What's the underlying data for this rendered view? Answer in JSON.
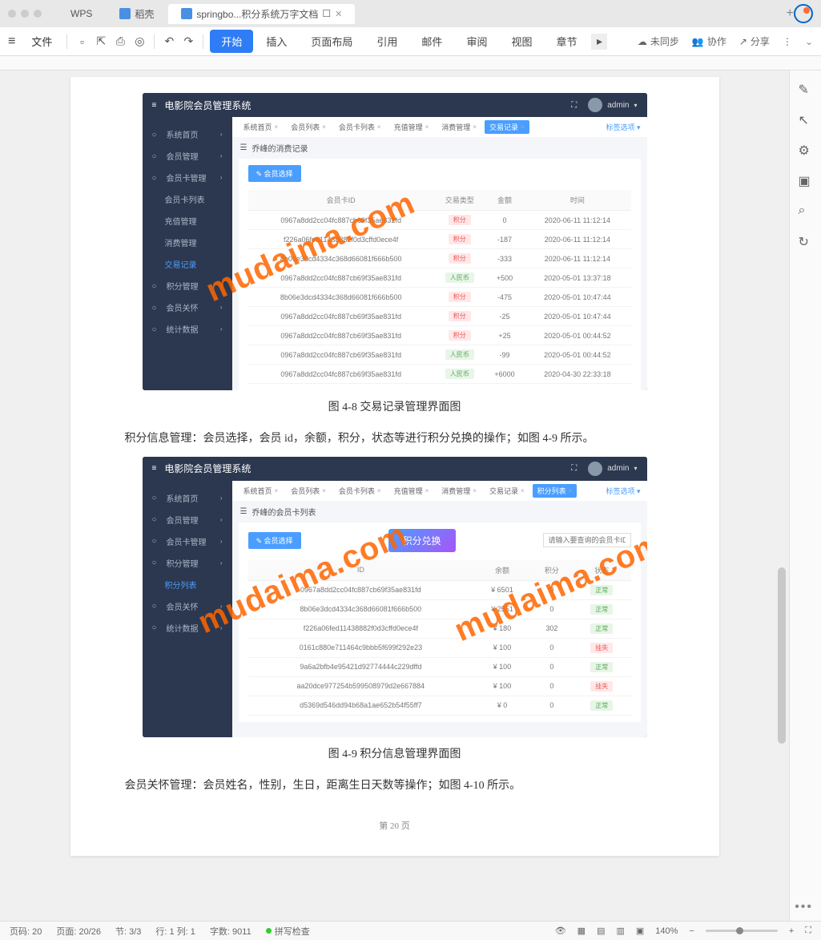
{
  "titlebar": {
    "tabs": [
      {
        "label": "WPS"
      },
      {
        "label": "稻壳"
      },
      {
        "label": "springbo...积分系统万字文档",
        "active": true
      }
    ]
  },
  "menubar": {
    "file": "文件",
    "items": [
      "开始",
      "插入",
      "页面布局",
      "引用",
      "邮件",
      "审阅",
      "视图",
      "章节"
    ],
    "active": 0,
    "sync": [
      {
        "label": "未同步"
      },
      {
        "label": "协作"
      },
      {
        "label": "分享"
      }
    ]
  },
  "doc": {
    "caption1": "图 4-8 交易记录管理界面图",
    "paragraph1": "积分信息管理：会员选择，会员 id，余额，积分，状态等进行积分兑换的操作；如图 4-9 所示。",
    "caption2": "图 4-9 积分信息管理界面图",
    "paragraph2": "会员关怀管理：会员姓名，性别，生日，距离生日天数等操作；如图 4-10 所示。",
    "pagefoot": "第 20 页"
  },
  "embed1": {
    "title": "电影院会员管理系统",
    "admin": "admin",
    "sidebar": [
      "系统首页",
      "会员管理",
      "会员卡管理",
      "会员卡列表",
      "充值管理",
      "消费管理",
      "交易记录",
      "积分管理",
      "会员关怀",
      "统计数据"
    ],
    "sidebar_active": 6,
    "breadcrumbs": [
      "系统首页",
      "会员列表",
      "会员卡列表",
      "充值管理",
      "消费管理",
      "交易记录"
    ],
    "bc_active": 5,
    "tag_select": "标签选项",
    "panel_title": "乔峰的消费记录",
    "select_btn": "会员选择",
    "columns": [
      "会员卡ID",
      "交易类型",
      "金额",
      "时间"
    ],
    "rows": [
      {
        "id": "0967a8dd2cc04fc887cb69f35ae831fd",
        "type": "积分",
        "tc": "jf",
        "amt": "0",
        "time": "2020-06-11 11:12:14"
      },
      {
        "id": "f226a06fed11438882f0d3cffd0ece4f",
        "type": "积分",
        "tc": "jf",
        "amt": "-187",
        "time": "2020-06-11 11:12:14"
      },
      {
        "id": "8b06e3dcd4334c368d66081f666b500",
        "type": "积分",
        "tc": "jf",
        "amt": "-333",
        "time": "2020-06-11 11:12:14"
      },
      {
        "id": "0967a8dd2cc04fc887cb69f35ae831fd",
        "type": "人民币",
        "tc": "rmb",
        "amt": "+500",
        "time": "2020-05-01 13:37:18"
      },
      {
        "id": "8b06e3dcd4334c368d66081f666b500",
        "type": "积分",
        "tc": "jf",
        "amt": "-475",
        "time": "2020-05-01 10:47:44"
      },
      {
        "id": "0967a8dd2cc04fc887cb69f35ae831fd",
        "type": "积分",
        "tc": "jf",
        "amt": "-25",
        "time": "2020-05-01 10:47:44"
      },
      {
        "id": "0967a8dd2cc04fc887cb69f35ae831fd",
        "type": "积分",
        "tc": "jf",
        "amt": "+25",
        "time": "2020-05-01 00:44:52"
      },
      {
        "id": "0967a8dd2cc04fc887cb69f35ae831fd",
        "type": "人民币",
        "tc": "rmb",
        "amt": "-99",
        "time": "2020-05-01 00:44:52"
      },
      {
        "id": "0967a8dd2cc04fc887cb69f35ae831fd",
        "type": "人民币",
        "tc": "rmb",
        "amt": "+6000",
        "time": "2020-04-30 22:33:18"
      }
    ]
  },
  "embed2": {
    "title": "电影院会员管理系统",
    "admin": "admin",
    "sidebar": [
      "系统首页",
      "会员管理",
      "会员卡管理",
      "积分管理",
      "积分列表",
      "会员关怀",
      "统计数据"
    ],
    "sidebar_active": 4,
    "breadcrumbs": [
      "系统首页",
      "会员列表",
      "会员卡列表",
      "充值管理",
      "消费管理",
      "交易记录",
      "积分列表"
    ],
    "bc_active": 6,
    "tag_select": "标签选项",
    "panel_title": "乔峰的会员卡列表",
    "select_btn": "会员选择",
    "exchange": "积分兑换",
    "search_placeholder": "请输入要查询的会员卡ID",
    "columns": [
      "ID",
      "余额",
      "积分",
      "状态"
    ],
    "rows": [
      {
        "id": "0967a8dd2cc04fc887cb69f35ae831fd",
        "bal": "¥ 6501",
        "pts": "0",
        "status": "正常",
        "sc": "zc"
      },
      {
        "id": "8b06e3dcd4334c368d66081f666b500",
        "bal": "¥ 2551",
        "pts": "0",
        "status": "正常",
        "sc": "zc"
      },
      {
        "id": "f226a06fed11438882f0d3cffd0ece4f",
        "bal": "¥ 180",
        "pts": "302",
        "status": "正常",
        "sc": "zc"
      },
      {
        "id": "0161c880e711464c9bbb5f699f292e23",
        "bal": "¥ 100",
        "pts": "0",
        "status": "挂失",
        "sc": "gs"
      },
      {
        "id": "9a6a2bfb4e95421d92774444c229dffd",
        "bal": "¥ 100",
        "pts": "0",
        "status": "正常",
        "sc": "zc"
      },
      {
        "id": "aa20dce977254b599508979d2e667884",
        "bal": "¥ 100",
        "pts": "0",
        "status": "挂失",
        "sc": "gs"
      },
      {
        "id": "d5369d546dd94b68a1ae652b54f55ff7",
        "bal": "¥ 0",
        "pts": "0",
        "status": "正常",
        "sc": "zc"
      }
    ]
  },
  "statusbar": {
    "items": [
      "页码: 20",
      "页面: 20/26",
      "节: 3/3",
      "行: 1  列: 1",
      "字数: 9011",
      "拼写检查"
    ],
    "zoom": "140%"
  },
  "watermark": "mudaima.com"
}
